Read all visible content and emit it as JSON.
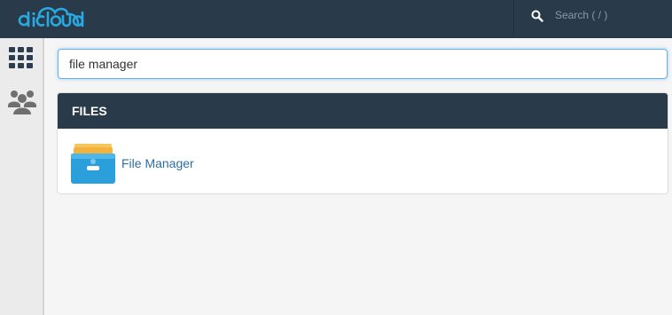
{
  "header": {
    "logo_text": "dicloud",
    "search_placeholder": "Search ( / )"
  },
  "sidebar": {
    "items": [
      {
        "icon": "grid-icon",
        "label": "Tools"
      },
      {
        "icon": "users-icon",
        "label": "Users"
      }
    ]
  },
  "search": {
    "value": "file manager"
  },
  "results": {
    "section_title": "FILES",
    "items": [
      {
        "label": "File Manager",
        "icon": "file-manager-icon"
      }
    ]
  },
  "colors": {
    "topbar": "#293a4a",
    "accent": "#29a9e1",
    "link": "#2d6ea3"
  }
}
